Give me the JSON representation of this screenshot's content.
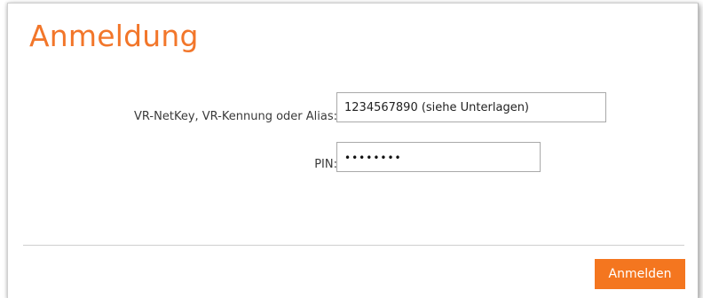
{
  "login": {
    "title": "Anmeldung",
    "user_label": "VR-NetKey, VR-Kennung oder Alias:",
    "user_value": "1234567890 (siehe Unterlagen)",
    "pin_label": "PIN:",
    "pin_value": "••••••••",
    "submit_label": "Anmelden"
  },
  "colors": {
    "accent": "#f4761f",
    "title": "#f2762a"
  }
}
